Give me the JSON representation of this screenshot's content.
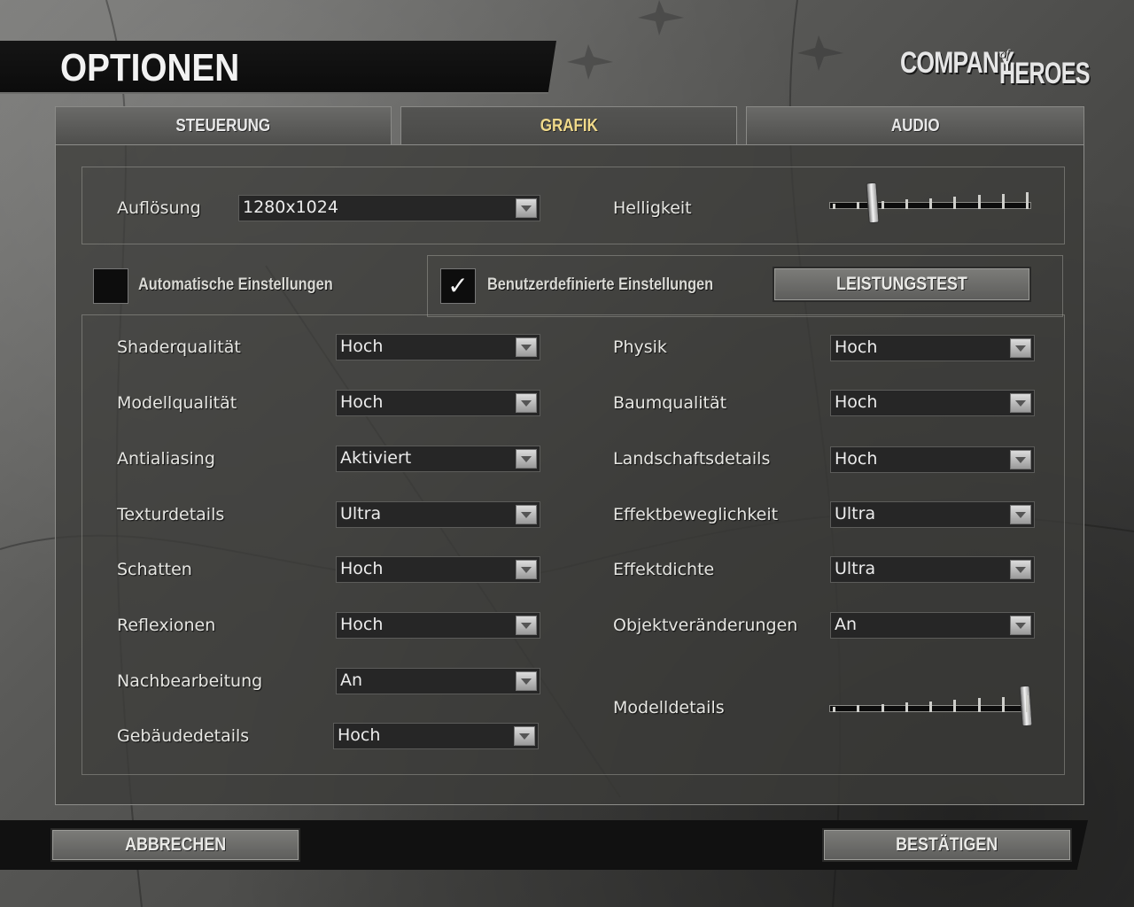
{
  "title": "OPTIONEN",
  "logo": {
    "company": "COMPANY",
    "of": "of",
    "heroes": "HEROES"
  },
  "tabs": [
    {
      "label": "STEUERUNG",
      "active": false
    },
    {
      "label": "GRAFIK",
      "active": true
    },
    {
      "label": "AUDIO",
      "active": false
    }
  ],
  "top_settings": {
    "resolution_label": "Auflösung",
    "resolution_value": "1280x1024",
    "brightness_label": "Helligkeit",
    "brightness_level": 0.2
  },
  "modes": {
    "auto_label": "Automatische Einstellungen",
    "auto_checked": false,
    "custom_label": "Benutzerdefinierte Einstellungen",
    "custom_checked": true,
    "check_glyph": "✓",
    "benchmark_label": "LEISTUNGSTEST"
  },
  "left_settings": [
    {
      "label": "Shaderqualität",
      "value": "Hoch"
    },
    {
      "label": "Modellqualität",
      "value": "Hoch"
    },
    {
      "label": "Antialiasing",
      "value": "Aktiviert"
    },
    {
      "label": "Texturdetails",
      "value": "Ultra"
    },
    {
      "label": "Schatten",
      "value": "Hoch"
    },
    {
      "label": "Reflexionen",
      "value": "Hoch"
    },
    {
      "label": "Nachbearbeitung",
      "value": "An"
    },
    {
      "label": "Gebäudedetails",
      "value": "Hoch"
    }
  ],
  "right_settings": [
    {
      "label": "Physik",
      "value": "Hoch"
    },
    {
      "label": "Baumqualität",
      "value": "Hoch"
    },
    {
      "label": "Landschaftsdetails",
      "value": "Hoch"
    },
    {
      "label": "Effektbeweglichkeit",
      "value": "Ultra"
    },
    {
      "label": "Effektdichte",
      "value": "Ultra"
    },
    {
      "label": "Objektveränderungen",
      "value": "An"
    }
  ],
  "model_details": {
    "label": "Modelldetails",
    "level": 1.0
  },
  "footer": {
    "cancel_label": "ABBRECHEN",
    "confirm_label": "BESTÄTIGEN"
  },
  "colors": {
    "active_tab": "#f0d98a",
    "text": "#e6e6e2",
    "panel": "#3c3c3a"
  }
}
